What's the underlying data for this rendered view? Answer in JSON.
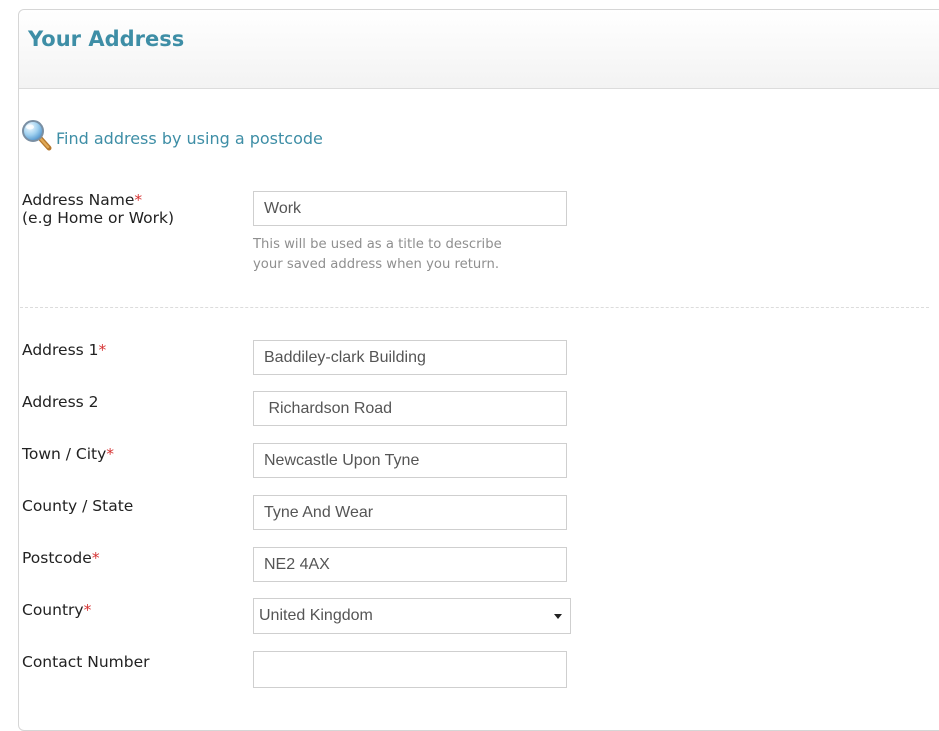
{
  "panel": {
    "title": "Your Address"
  },
  "find_address": {
    "label": "Find address by using a postcode",
    "icon": "magnifier-icon"
  },
  "address_name": {
    "label": "Address Name",
    "sublabel": "(e.g Home or Work)",
    "value": "Work",
    "help_line1": "This will be used as a title to describe",
    "help_line2": "your saved address when you return."
  },
  "fields": {
    "address1": {
      "label": "Address 1",
      "value": "Baddiley-clark Building"
    },
    "address2": {
      "label": "Address 2",
      "value": " Richardson Road"
    },
    "town": {
      "label": "Town / City",
      "value": "Newcastle Upon Tyne"
    },
    "county": {
      "label": "County / State",
      "value": "Tyne And Wear"
    },
    "postcode": {
      "label": "Postcode",
      "value": "NE2 4AX"
    },
    "country": {
      "label": "Country",
      "value": "United Kingdom"
    },
    "contact": {
      "label": "Contact Number",
      "value": ""
    }
  },
  "required_marker": "*",
  "colors": {
    "accent": "#3e8ea6",
    "required": "#d63333"
  }
}
